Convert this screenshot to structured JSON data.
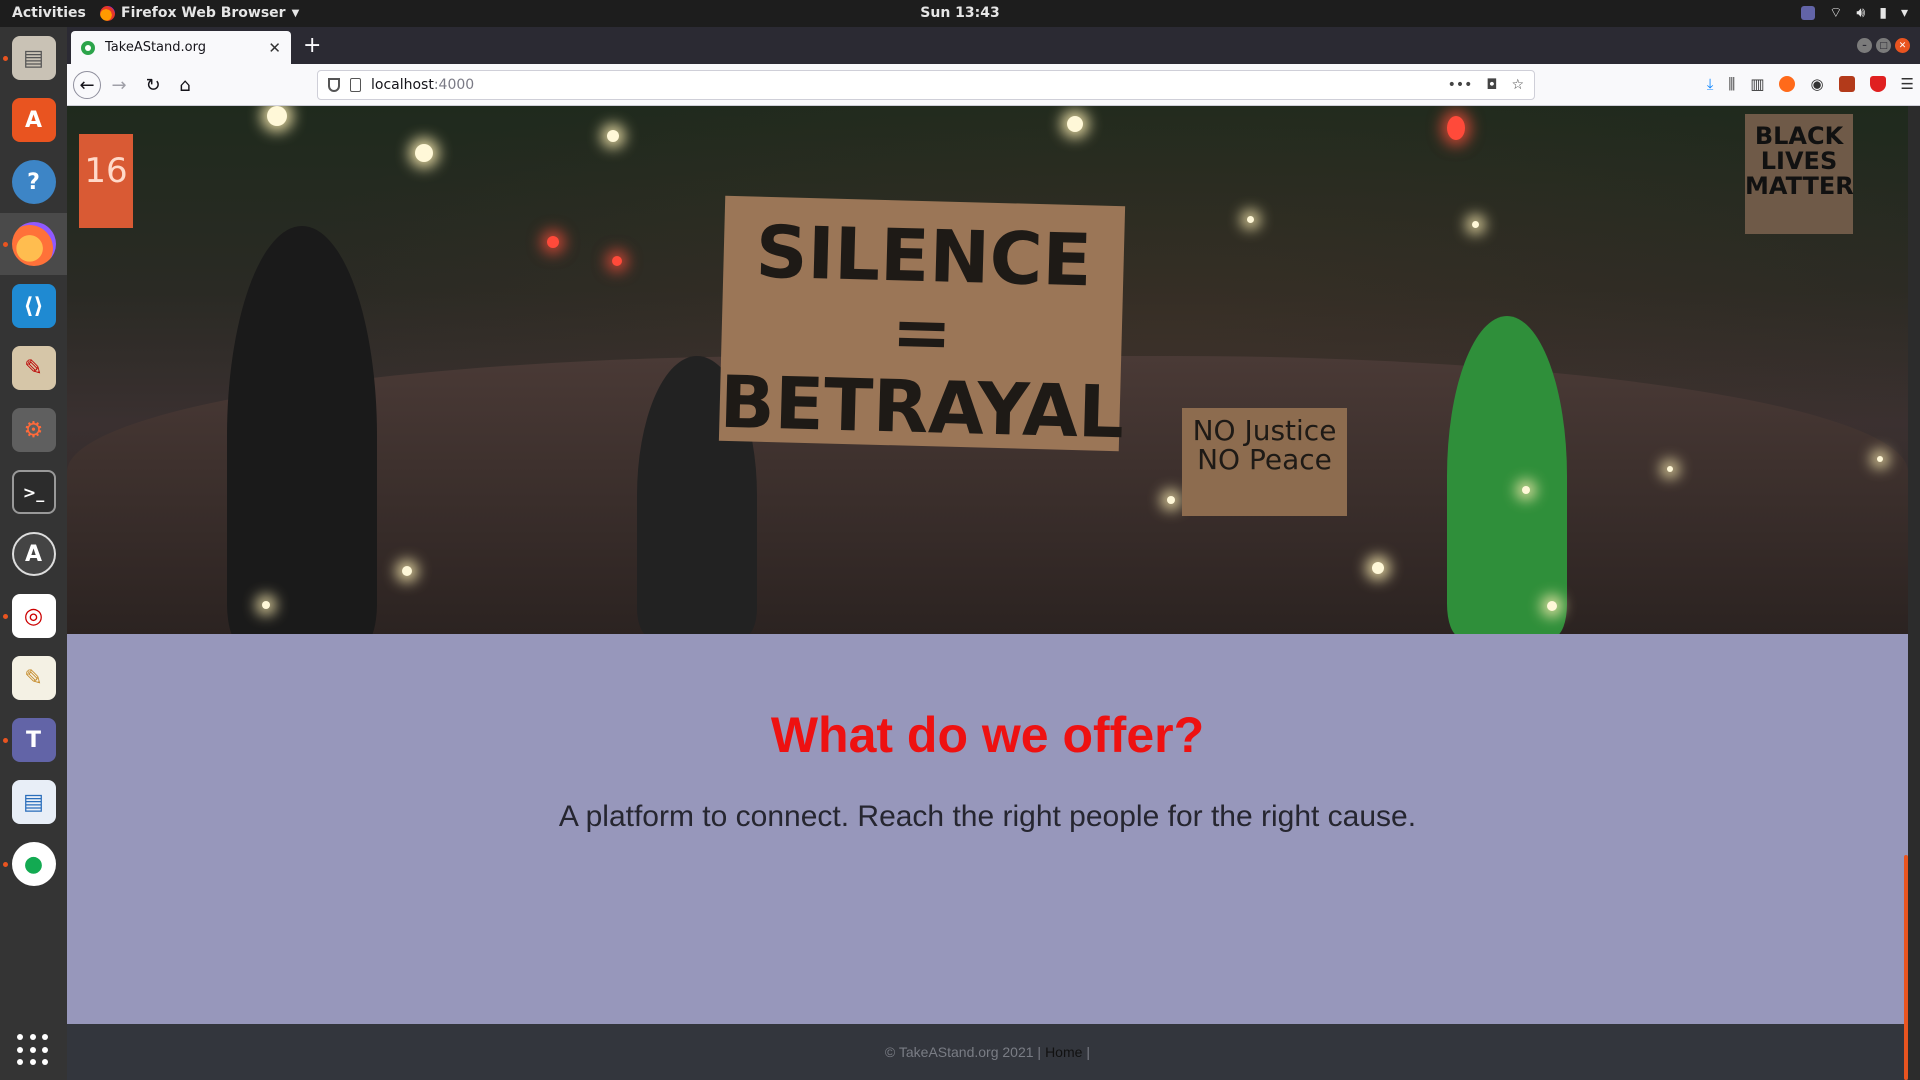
{
  "topbar": {
    "activities": "Activities",
    "app_name": "Firefox Web Browser",
    "clock": "Sun 13:43"
  },
  "dock": {
    "items": [
      {
        "name": "files-icon",
        "color": "#c9c2b5"
      },
      {
        "name": "software-store-icon",
        "color": "#e95420"
      },
      {
        "name": "help-icon",
        "color": "#3d85c6"
      },
      {
        "name": "firefox-icon",
        "color": "#ff7139"
      },
      {
        "name": "vscode-icon",
        "color": "#1f8ad2"
      },
      {
        "name": "text-editor-tool-icon",
        "color": "#d6c6a8"
      },
      {
        "name": "settings-tools-icon",
        "color": "#b34a2c"
      },
      {
        "name": "terminal-icon",
        "color": "#2c2c2c"
      },
      {
        "name": "software-updater-icon",
        "color": "#444444"
      },
      {
        "name": "remote-app-icon",
        "color": "#ffffff"
      },
      {
        "name": "notes-icon",
        "color": "#f4f1e4"
      },
      {
        "name": "teams-icon",
        "color": "#6264a7"
      },
      {
        "name": "writer-icon",
        "color": "#2a6ebb"
      },
      {
        "name": "mongodb-compass-icon",
        "color": "#ffffff"
      }
    ]
  },
  "browser": {
    "tab_title": "TakeAStand.org",
    "url_host": "localhost",
    "url_port": ":4000"
  },
  "hero": {
    "sign_main": "SILENCE = BETRAYAL",
    "sign_justice": "NO Justice NO Peace",
    "sign_blm": "BLACK LIVES MATTER",
    "banner_number": "16"
  },
  "offer": {
    "title": "What do we offer?",
    "text": "A platform to connect. Reach the right people for the right cause."
  },
  "footer": {
    "copyright": "© TakeAStand.org 2021 |",
    "home_link": "Home",
    "trailing": "|"
  },
  "colors": {
    "offer_bg": "#9797bb",
    "title_red": "#ee1111",
    "footer_bg": "#33363d",
    "ubuntu_orange": "#e95420"
  }
}
